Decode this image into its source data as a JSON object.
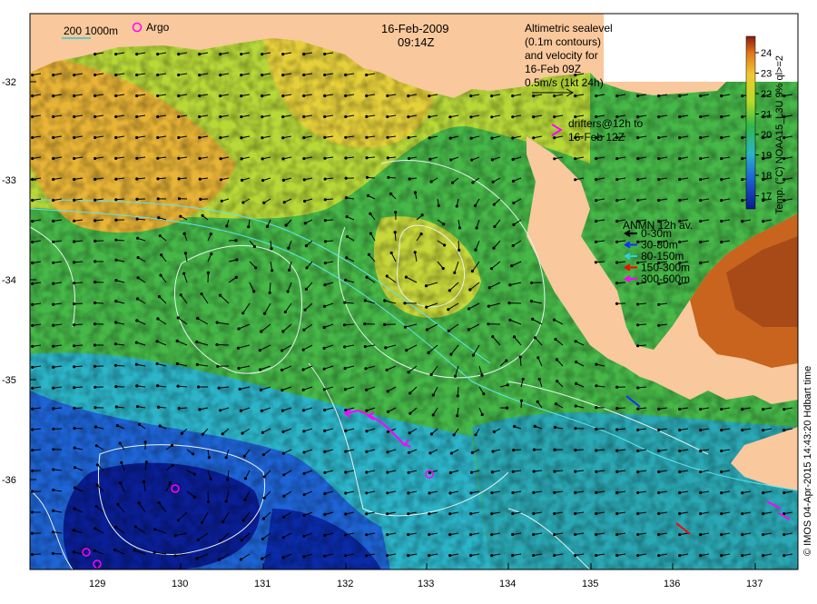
{
  "map": {
    "date": "16-Feb-2009",
    "time": "09:14Z",
    "scale_bar": "200  1000m",
    "argo_label": "Argo",
    "altimetry_lines": [
      "Altimetric sealevel",
      "(0.1m contours)",
      "and velocity for",
      "16-Feb 09Z",
      "0.5m/s (1kt 24h)"
    ],
    "drifters_lines": [
      "drifters@12h to",
      "16-Feb 12Z"
    ],
    "anmn": {
      "title": "ANMN 12h av.",
      "bands": [
        {
          "label": "0-30m",
          "color": "#000000"
        },
        {
          "label": "30-80m",
          "color": "#1030ff"
        },
        {
          "label": "80-150m",
          "color": "#30d0e0"
        },
        {
          "label": "150-300m",
          "color": "#ff0000"
        },
        {
          "label": "300-600m",
          "color": "#ff00ff"
        }
      ]
    },
    "colorbar": {
      "title": "Temp. (°C) NOAA15_L3U 9% ql>=2",
      "ticks": [
        "24",
        "23",
        "22",
        "21",
        "20",
        "19",
        "18",
        "17"
      ]
    },
    "credit": "© IMOS 04-Apr-2015 14:43:20 Hdbart time",
    "lat_ticks": [
      "-32",
      "-33",
      "-34",
      "-35",
      "-36"
    ],
    "lon_ticks": [
      "129",
      "130",
      "131",
      "132",
      "133",
      "134",
      "135",
      "136",
      "137"
    ],
    "colors": {
      "land": "#f9c89c",
      "warm": "#e8b436",
      "mid": "#8cc83c",
      "green": "#2eb84a",
      "cyan": "#2cb4c8",
      "blue": "#1e64d6",
      "deep": "#0a1e96"
    }
  }
}
